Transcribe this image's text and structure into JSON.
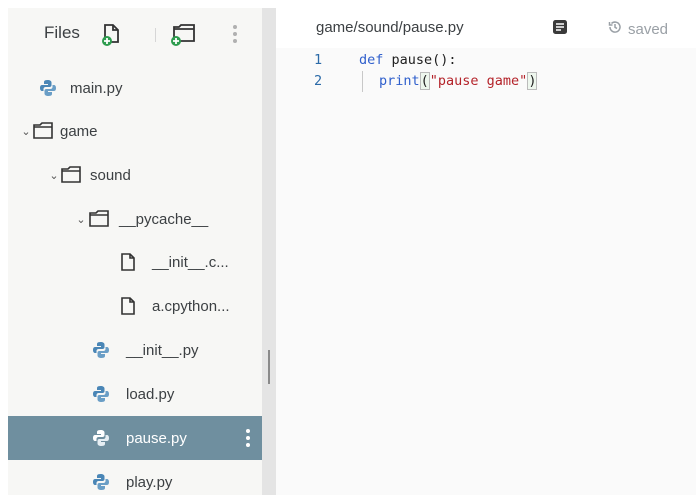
{
  "sidebar": {
    "title": "Files",
    "items": [
      {
        "label": "main.py",
        "type": "python"
      },
      {
        "label": "game",
        "type": "folder"
      },
      {
        "label": "sound",
        "type": "folder"
      },
      {
        "label": "__pycache__",
        "type": "folder"
      },
      {
        "label": "__init__.c...",
        "type": "file"
      },
      {
        "label": "a.cpython...",
        "type": "file"
      },
      {
        "label": "__init__.py",
        "type": "python"
      },
      {
        "label": "load.py",
        "type": "python"
      },
      {
        "label": "pause.py",
        "type": "python",
        "selected": true
      },
      {
        "label": "play.py",
        "type": "python"
      }
    ]
  },
  "editor": {
    "tab_path": "game/sound/pause.py",
    "status": "saved",
    "lines": [
      {
        "num": "1"
      },
      {
        "num": "2"
      }
    ],
    "code": {
      "line1_kw": "def",
      "line1_rest": " pause():",
      "line2_fn": "print",
      "line2_open": "(",
      "line2_str": "\"pause game\"",
      "line2_close": ")"
    }
  },
  "colors": {
    "selected_row": "#6f8f9f",
    "python_icon": "#4a86b6",
    "add_icon_green": "#2e9c4e",
    "keyword": "#2f5fcc",
    "string": "#b4232a"
  }
}
